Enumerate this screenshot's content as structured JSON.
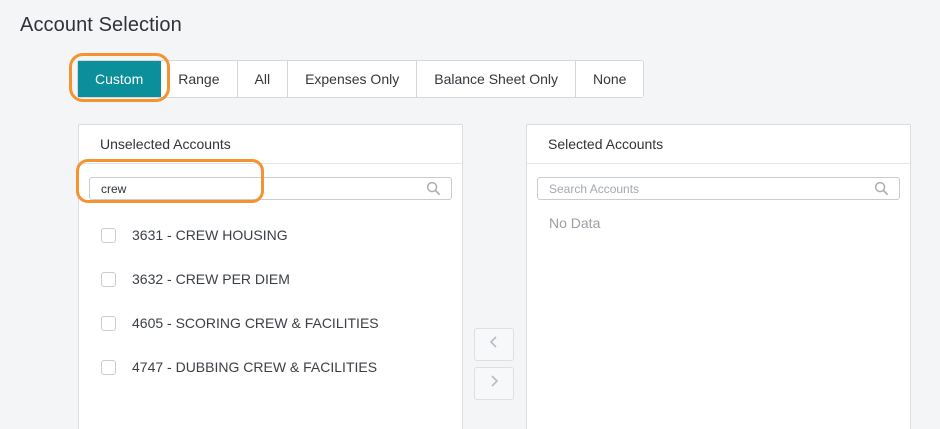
{
  "page": {
    "title": "Account Selection"
  },
  "selection_modes": {
    "active": "Custom",
    "options": [
      "Custom",
      "Range",
      "All",
      "Expenses Only",
      "Balance Sheet Only",
      "None"
    ]
  },
  "unselected": {
    "title": "Unselected Accounts",
    "search_value": "crew",
    "search_placeholder": "Search Accounts",
    "items": [
      "3631 - CREW HOUSING",
      "3632 - CREW PER DIEM",
      "4605 - SCORING CREW & FACILITIES",
      "4747 - DUBBING CREW & FACILITIES"
    ]
  },
  "selected": {
    "title": "Selected Accounts",
    "search_value": "",
    "search_placeholder": "Search Accounts",
    "empty_text": "No Data"
  },
  "colors": {
    "accent": "#0b8f9a",
    "highlight": "#f6922f"
  },
  "icons": {
    "search": "search-icon",
    "move_left": "chevron-left-icon",
    "move_right": "chevron-right-icon"
  }
}
